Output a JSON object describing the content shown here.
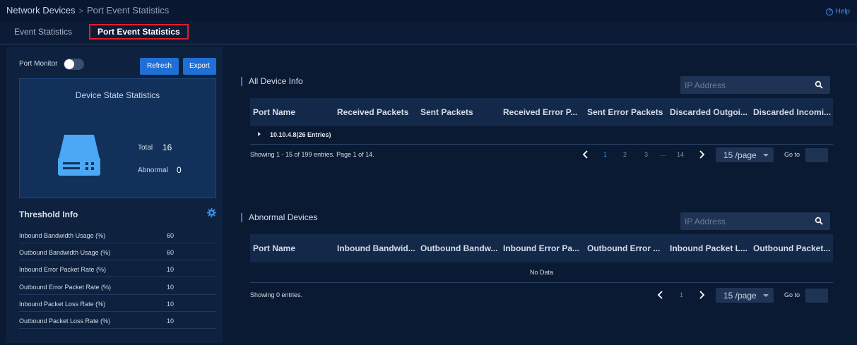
{
  "breadcrumb": {
    "root": "Network Devices",
    "separator": ">",
    "current": "Port Event Statistics"
  },
  "help": {
    "label": "Help",
    "icon": "help-circle-icon"
  },
  "tabs": [
    {
      "label": "Event Statistics",
      "active": false
    },
    {
      "label": "Port Event Statistics",
      "active": true
    }
  ],
  "left": {
    "port_monitor_label": "Port Monitor",
    "port_monitor_on": false,
    "refresh_label": "Refresh",
    "export_label": "Export",
    "device_state": {
      "title": "Device State Statistics",
      "icon": "server-icon",
      "total_label": "Total",
      "total_value": "16",
      "abnormal_label": "Abnormal",
      "abnormal_value": "0"
    },
    "threshold": {
      "title": "Threshold Info",
      "icon": "gear-icon",
      "rows": [
        {
          "label": "Inbound Bandwidth Usage (%)",
          "value": "60"
        },
        {
          "label": "Outbound Bandwidth Usage (%)",
          "value": "60"
        },
        {
          "label": "Inbound Error Packet Rate (%)",
          "value": "10"
        },
        {
          "label": "Outbound Error Packet Rate (%)",
          "value": "10"
        },
        {
          "label": "Inbound Packet Loss Rate (%)",
          "value": "10"
        },
        {
          "label": "Outbound Packet Loss Rate (%)",
          "value": "10"
        }
      ]
    }
  },
  "all_devices": {
    "title": "All Device Info",
    "search_placeholder": "IP Address",
    "columns": [
      "Port Name",
      "Received Packets",
      "Sent Packets",
      "Received Error P...",
      "Sent Error Packets",
      "Discarded Outgoi...",
      "Discarded Incomi..."
    ],
    "group_label": "10.10.4.8(26 Entries)",
    "pagination": {
      "info": "Showing 1 - 15 of 199 entries. Page 1 of 14.",
      "pages": [
        "1",
        "2",
        "3",
        "...",
        "14"
      ],
      "current_page": "1",
      "page_size": "15 /page",
      "goto_label": "Go to"
    }
  },
  "abnormal_devices": {
    "title": "Abnormal Devices",
    "search_placeholder": "IP Address",
    "columns": [
      "Port Name",
      "Inbound Bandwid...",
      "Outbound Bandw...",
      "Inbound Error Pa...",
      "Outbound Error ...",
      "Inbound Packet L...",
      "Outbound Packet..."
    ],
    "empty_text": "No Data",
    "pagination": {
      "info": "Showing 0 entries.",
      "pages": [
        "1"
      ],
      "current_page": "1",
      "page_size": "15 /page",
      "goto_label": "Go to"
    }
  },
  "colors": {
    "accent": "#1f6fd4",
    "active_tab_outline": "#e31d2c",
    "background": "#0b1a33",
    "server_icon": "#4aa8f5"
  }
}
